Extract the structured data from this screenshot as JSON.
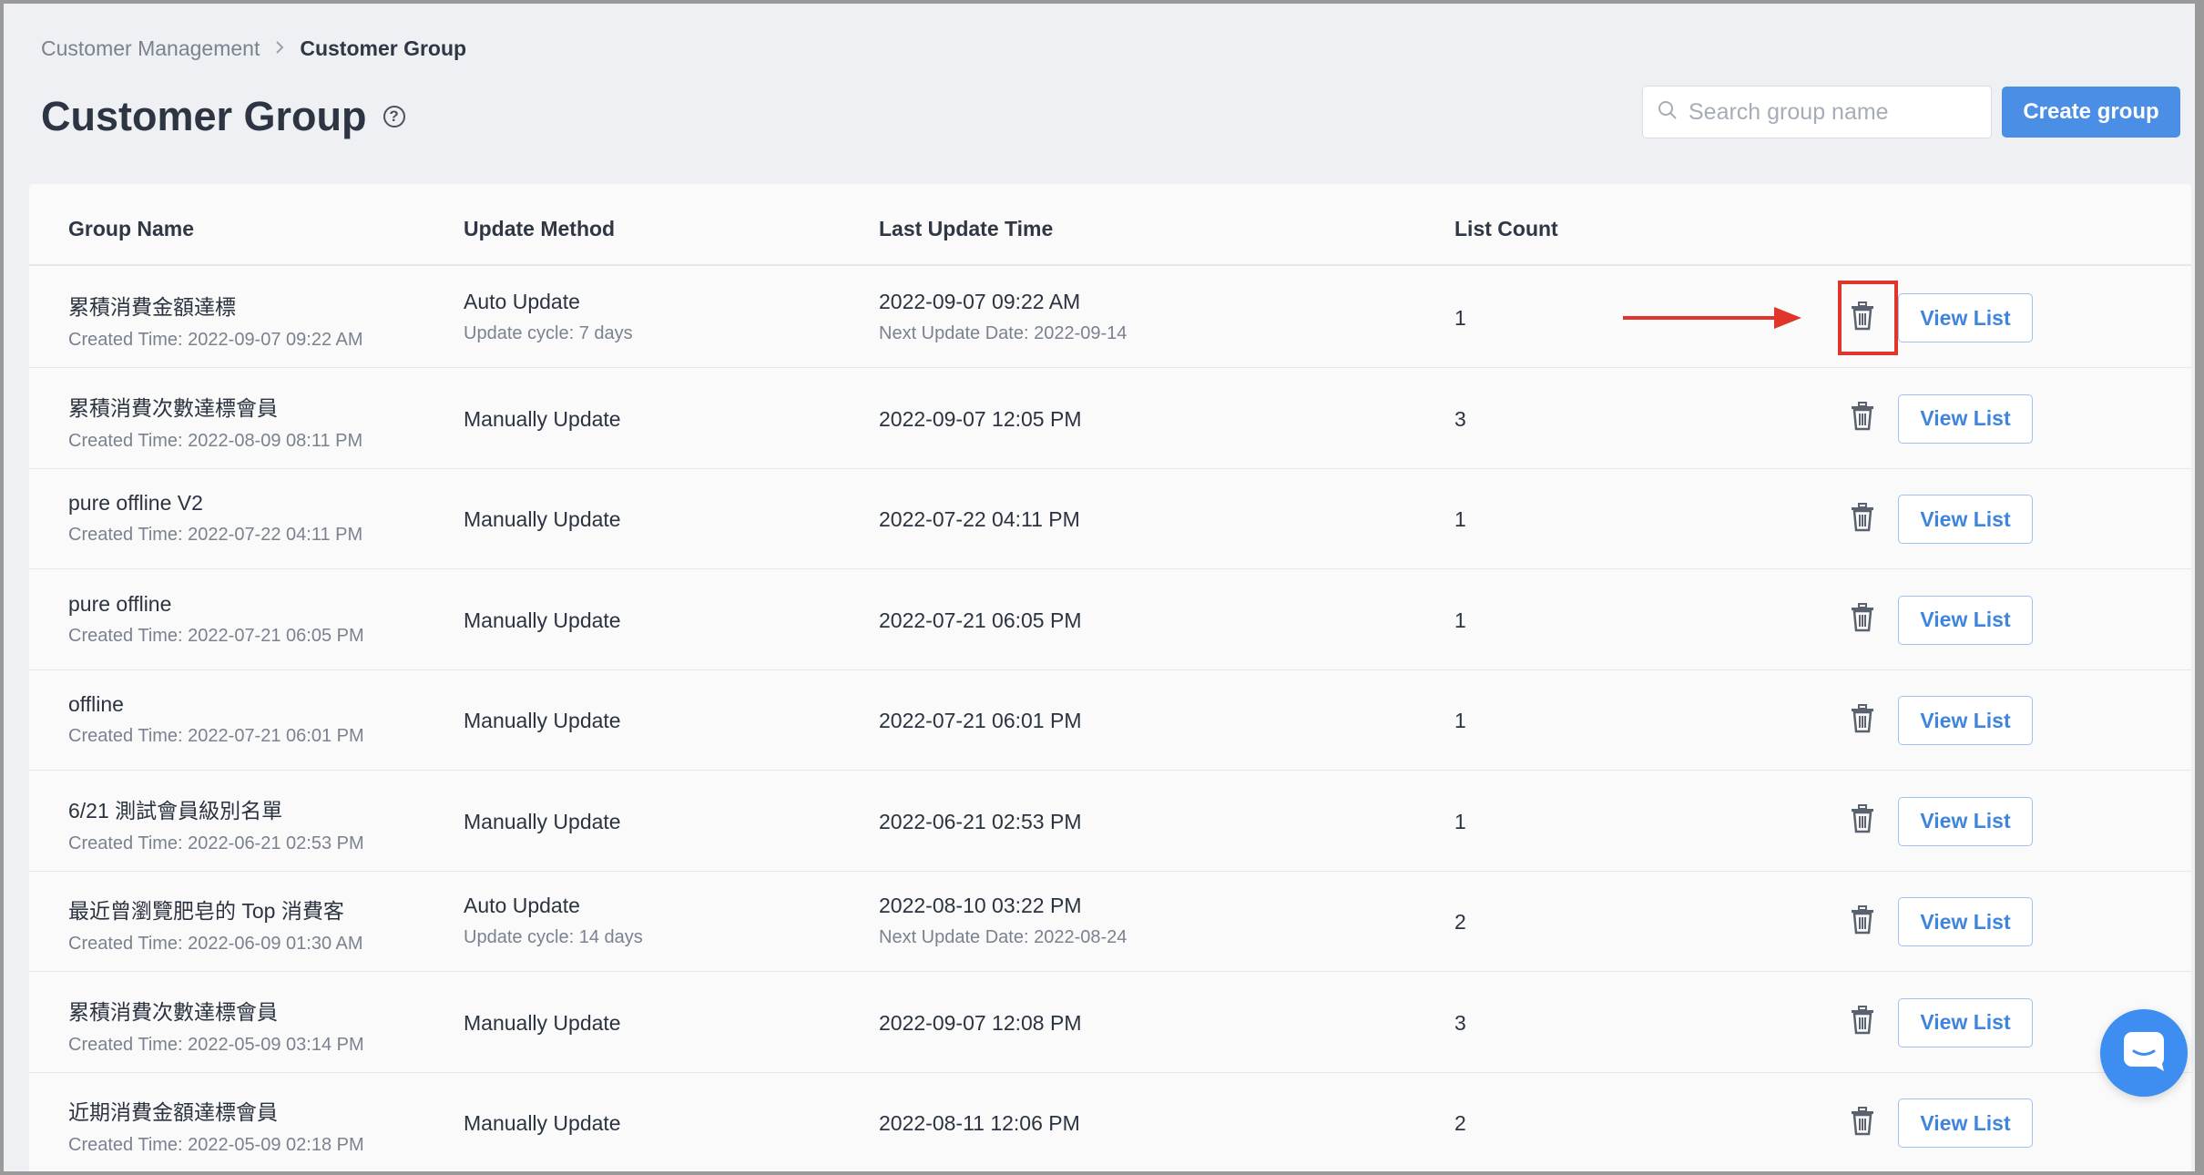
{
  "breadcrumb": {
    "parent": "Customer Management",
    "separator": ">",
    "current": "Customer Group"
  },
  "header": {
    "title": "Customer Group",
    "help_glyph": "?"
  },
  "search": {
    "placeholder": "Search group name"
  },
  "actions": {
    "create_label": "Create group",
    "view_label": "View List"
  },
  "table": {
    "columns": [
      "Group Name",
      "Update Method",
      "Last Update Time",
      "List Count"
    ],
    "rows": [
      {
        "name": "累積消費金額達標",
        "created": "Created Time: 2022-09-07 09:22 AM",
        "method": "Auto Update",
        "cycle": "Update cycle: 7 days",
        "last_update": "2022-09-07 09:22 AM",
        "next_update": "Next Update Date: 2022-09-14",
        "count": "1"
      },
      {
        "name": "累積消費次數達標會員",
        "created": "Created Time: 2022-08-09 08:11 PM",
        "method": "Manually Update",
        "cycle": "",
        "last_update": "2022-09-07 12:05 PM",
        "next_update": "",
        "count": "3"
      },
      {
        "name": "pure offline V2",
        "created": "Created Time: 2022-07-22 04:11 PM",
        "method": "Manually Update",
        "cycle": "",
        "last_update": "2022-07-22 04:11 PM",
        "next_update": "",
        "count": "1"
      },
      {
        "name": "pure offline",
        "created": "Created Time: 2022-07-21 06:05 PM",
        "method": "Manually Update",
        "cycle": "",
        "last_update": "2022-07-21 06:05 PM",
        "next_update": "",
        "count": "1"
      },
      {
        "name": "offline",
        "created": "Created Time: 2022-07-21 06:01 PM",
        "method": "Manually Update",
        "cycle": "",
        "last_update": "2022-07-21 06:01 PM",
        "next_update": "",
        "count": "1"
      },
      {
        "name": "6/21 測試會員級別名單",
        "created": "Created Time: 2022-06-21 02:53 PM",
        "method": "Manually Update",
        "cycle": "",
        "last_update": "2022-06-21 02:53 PM",
        "next_update": "",
        "count": "1"
      },
      {
        "name": "最近曾瀏覽肥皂的 Top 消費客",
        "created": "Created Time: 2022-06-09 01:30 AM",
        "method": "Auto Update",
        "cycle": "Update cycle: 14 days",
        "last_update": "2022-08-10 03:22 PM",
        "next_update": "Next Update Date: 2022-08-24",
        "count": "2"
      },
      {
        "name": "累積消費次數達標會員",
        "created": "Created Time: 2022-05-09 03:14 PM",
        "method": "Manually Update",
        "cycle": "",
        "last_update": "2022-09-07 12:08 PM",
        "next_update": "",
        "count": "3"
      },
      {
        "name": "近期消費金額達標會員",
        "created": "Created Time: 2022-05-09 02:18 PM",
        "method": "Manually Update",
        "cycle": "",
        "last_update": "2022-08-11 12:06 PM",
        "next_update": "",
        "count": "2"
      }
    ]
  },
  "annotation": {
    "color": "#e0352b"
  },
  "colors": {
    "accent": "#4a8ee6",
    "chat": "#3d8ef0"
  }
}
